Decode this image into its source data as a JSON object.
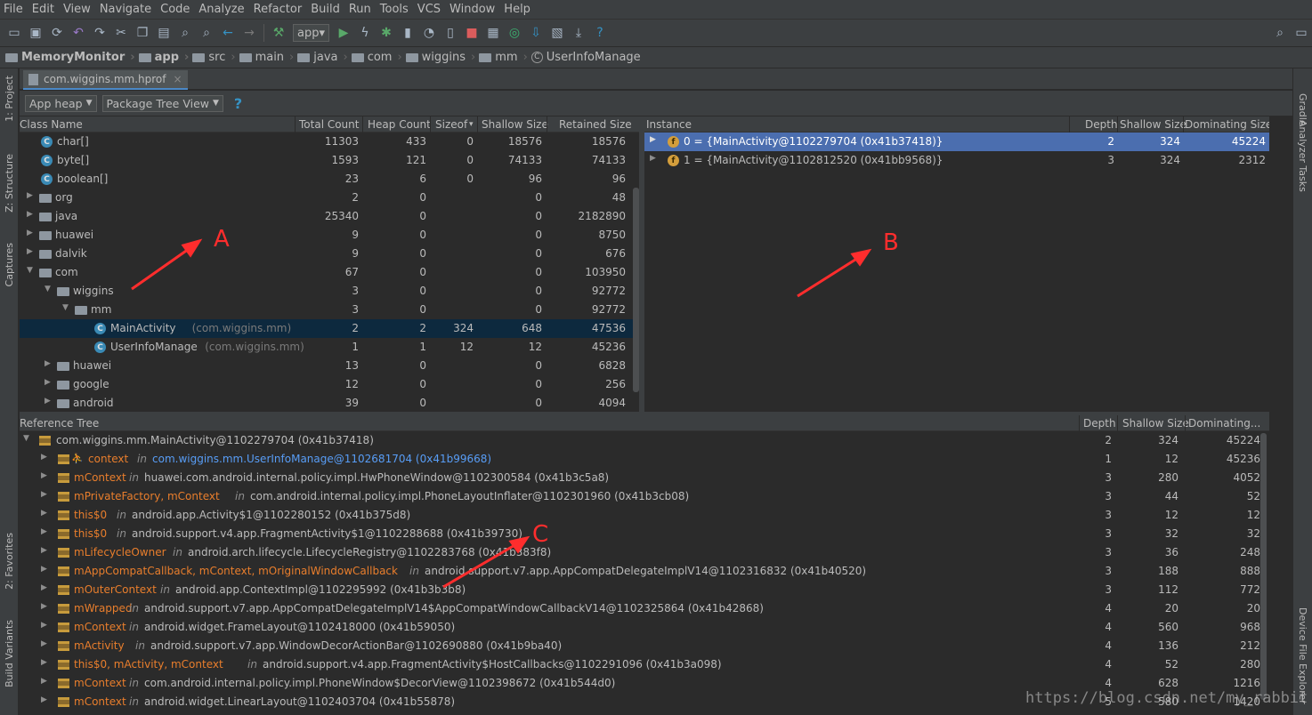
{
  "menu": [
    "File",
    "Edit",
    "View",
    "Navigate",
    "Code",
    "Analyze",
    "Refactor",
    "Build",
    "Run",
    "Tools",
    "VCS",
    "Window",
    "Help"
  ],
  "toolbar": {
    "run_config": "app",
    "icons": [
      "open-icon",
      "save-icon",
      "sync-icon",
      "undo-icon",
      "redo-icon",
      "cut-icon",
      "copy-icon",
      "paste-icon",
      "find-icon",
      "replace-icon",
      "back-icon",
      "forward-icon",
      "build-icon",
      "run-icon",
      "apply-changes-icon",
      "debug-icon",
      "attach-icon",
      "profiler-icon",
      "coverage-icon",
      "stop-icon",
      "avd-icon",
      "sdk-icon",
      "sync-gradle-icon",
      "structure-icon",
      "device-icon",
      "help-icon",
      "search-icon",
      "layout-icon"
    ]
  },
  "breadcrumb": [
    "MemoryMonitor",
    "app",
    "src",
    "main",
    "java",
    "com",
    "wiggins",
    "mm",
    "UserInfoManage"
  ],
  "left_tabs": [
    "1: Project",
    "Z: Structure",
    "Captures",
    "2: Favorites",
    "Build Variants"
  ],
  "right_tabs": [
    "Gradle",
    "Analyzer Tasks",
    "Device File Explorer"
  ],
  "editor_tab": {
    "label": "com.wiggins.mm.hprof",
    "close": "×"
  },
  "hprof_toolbar": {
    "heap": "App heap",
    "view": "Package Tree View",
    "help": "?"
  },
  "class_table": {
    "columns": [
      "Class Name",
      "Total Count",
      "Heap Count",
      "Sizeof",
      "Shallow Size",
      "Retained Size"
    ],
    "sort_indicator": "▾",
    "rows": [
      {
        "name": "char[]",
        "pkg": "",
        "kind": "class",
        "indent": 0,
        "expand": "none",
        "total": "11303",
        "heap": "433",
        "sizeof": "0",
        "shallow": "18576",
        "retained": "18576"
      },
      {
        "name": "byte[]",
        "pkg": "",
        "kind": "class",
        "indent": 0,
        "expand": "none",
        "total": "1593",
        "heap": "121",
        "sizeof": "0",
        "shallow": "74133",
        "retained": "74133"
      },
      {
        "name": "boolean[]",
        "pkg": "",
        "kind": "class",
        "indent": 0,
        "expand": "none",
        "total": "23",
        "heap": "6",
        "sizeof": "0",
        "shallow": "96",
        "retained": "96"
      },
      {
        "name": "org",
        "pkg": "",
        "kind": "package",
        "indent": 0,
        "expand": "collapsed",
        "total": "2",
        "heap": "0",
        "sizeof": "",
        "shallow": "0",
        "retained": "48"
      },
      {
        "name": "java",
        "pkg": "",
        "kind": "package",
        "indent": 0,
        "expand": "collapsed",
        "total": "25340",
        "heap": "0",
        "sizeof": "",
        "shallow": "0",
        "retained": "2182890"
      },
      {
        "name": "huawei",
        "pkg": "",
        "kind": "package",
        "indent": 0,
        "expand": "collapsed",
        "total": "9",
        "heap": "0",
        "sizeof": "",
        "shallow": "0",
        "retained": "8750"
      },
      {
        "name": "dalvik",
        "pkg": "",
        "kind": "package",
        "indent": 0,
        "expand": "collapsed",
        "total": "9",
        "heap": "0",
        "sizeof": "",
        "shallow": "0",
        "retained": "676"
      },
      {
        "name": "com",
        "pkg": "",
        "kind": "package",
        "indent": 0,
        "expand": "expanded",
        "total": "67",
        "heap": "0",
        "sizeof": "",
        "shallow": "0",
        "retained": "103950"
      },
      {
        "name": "wiggins",
        "pkg": "",
        "kind": "package",
        "indent": 1,
        "expand": "expanded",
        "total": "3",
        "heap": "0",
        "sizeof": "",
        "shallow": "0",
        "retained": "92772"
      },
      {
        "name": "mm",
        "pkg": "",
        "kind": "package",
        "indent": 2,
        "expand": "expanded",
        "total": "3",
        "heap": "0",
        "sizeof": "",
        "shallow": "0",
        "retained": "92772"
      },
      {
        "name": "MainActivity",
        "pkg": "(com.wiggins.mm)",
        "kind": "class",
        "indent": 3,
        "expand": "none",
        "selected": true,
        "total": "2",
        "heap": "2",
        "sizeof": "324",
        "shallow": "648",
        "retained": "47536"
      },
      {
        "name": "UserInfoManage",
        "pkg": "(com.wiggins.mm)",
        "kind": "class",
        "indent": 3,
        "expand": "none",
        "total": "1",
        "heap": "1",
        "sizeof": "12",
        "shallow": "12",
        "retained": "45236"
      },
      {
        "name": "huawei",
        "pkg": "",
        "kind": "package",
        "indent": 1,
        "expand": "collapsed",
        "total": "13",
        "heap": "0",
        "sizeof": "",
        "shallow": "0",
        "retained": "6828"
      },
      {
        "name": "google",
        "pkg": "",
        "kind": "package",
        "indent": 1,
        "expand": "collapsed",
        "total": "12",
        "heap": "0",
        "sizeof": "",
        "shallow": "0",
        "retained": "256"
      },
      {
        "name": "android",
        "pkg": "",
        "kind": "package",
        "indent": 1,
        "expand": "collapsed",
        "total": "39",
        "heap": "0",
        "sizeof": "",
        "shallow": "0",
        "retained": "4094"
      }
    ]
  },
  "instance_table": {
    "columns": [
      "Instance",
      "Depth",
      "Shallow Size",
      "Dominating Size"
    ],
    "rows": [
      {
        "text": "0 = {MainActivity@1102279704 (0x41b37418)}",
        "depth": "2",
        "shallow": "324",
        "dominating": "45224",
        "selected": true
      },
      {
        "text": "1 = {MainActivity@1102812520 (0x41bb9568)}",
        "depth": "3",
        "shallow": "324",
        "dominating": "2312",
        "selected": false
      }
    ]
  },
  "reference_tree": {
    "columns": [
      "Reference Tree",
      "Depth",
      "Shallow Size",
      "Dominating..."
    ],
    "root": {
      "text": "com.wiggins.mm.MainActivity@1102279704 (0x41b37418)",
      "depth": "2",
      "shallow": "324",
      "dominating": "45224"
    },
    "rows": [
      {
        "field": "context",
        "in": "in",
        "target": "com.wiggins.mm.UserInfoManage@1102681704 (0x41b99668)",
        "depth": "1",
        "shallow": "12",
        "dominating": "45236",
        "highlight": true
      },
      {
        "field": "mContext",
        "in": "in",
        "target": "huawei.com.android.internal.policy.impl.HwPhoneWindow@1102300584 (0x41b3c5a8)",
        "depth": "3",
        "shallow": "280",
        "dominating": "4052"
      },
      {
        "field": "mPrivateFactory, mContext",
        "in": "in",
        "target": "com.android.internal.policy.impl.PhoneLayoutInflater@1102301960 (0x41b3cb08)",
        "depth": "3",
        "shallow": "44",
        "dominating": "52"
      },
      {
        "field": "this$0",
        "in": "in",
        "target": "android.app.Activity$1@1102280152 (0x41b375d8)",
        "depth": "3",
        "shallow": "12",
        "dominating": "12"
      },
      {
        "field": "this$0",
        "in": "in",
        "target": "android.support.v4.app.FragmentActivity$1@1102288688 (0x41b39730)",
        "depth": "3",
        "shallow": "32",
        "dominating": "32"
      },
      {
        "field": "mLifecycleOwner",
        "in": "in",
        "target": "android.arch.lifecycle.LifecycleRegistry@1102283768 (0x41b383f8)",
        "depth": "3",
        "shallow": "36",
        "dominating": "248"
      },
      {
        "field": "mAppCompatCallback, mContext, mOriginalWindowCallback",
        "in": "in",
        "target": "android.support.v7.app.AppCompatDelegateImplV14@1102316832 (0x41b40520)",
        "depth": "3",
        "shallow": "188",
        "dominating": "888"
      },
      {
        "field": "mOuterContext",
        "in": "in",
        "target": "android.app.ContextImpl@1102295992 (0x41b3b3b8)",
        "depth": "3",
        "shallow": "112",
        "dominating": "772"
      },
      {
        "field": "mWrapped",
        "in": "in",
        "target": "android.support.v7.app.AppCompatDelegateImplV14$AppCompatWindowCallbackV14@1102325864 (0x41b42868)",
        "depth": "4",
        "shallow": "20",
        "dominating": "20"
      },
      {
        "field": "mContext",
        "in": "in",
        "target": "android.widget.FrameLayout@1102418000 (0x41b59050)",
        "depth": "4",
        "shallow": "560",
        "dominating": "968"
      },
      {
        "field": "mActivity",
        "in": "in",
        "target": "android.support.v7.app.WindowDecorActionBar@1102690880 (0x41b9ba40)",
        "depth": "4",
        "shallow": "136",
        "dominating": "212"
      },
      {
        "field": "this$0, mActivity, mContext",
        "in": "in",
        "target": "android.support.v4.app.FragmentActivity$HostCallbacks@1102291096 (0x41b3a098)",
        "depth": "4",
        "shallow": "52",
        "dominating": "280"
      },
      {
        "field": "mContext",
        "in": "in",
        "target": "com.android.internal.policy.impl.PhoneWindow$DecorView@1102398672 (0x41b544d0)",
        "depth": "4",
        "shallow": "628",
        "dominating": "1216"
      },
      {
        "field": "mContext",
        "in": "in",
        "target": "android.widget.LinearLayout@1102403704 (0x41b55878)",
        "depth": "5",
        "shallow": "580",
        "dominating": "1420"
      }
    ]
  },
  "annotations": {
    "a": "A",
    "b": "B",
    "c": "C"
  },
  "watermark": "https://blog.csdn.net/my_rabbit"
}
